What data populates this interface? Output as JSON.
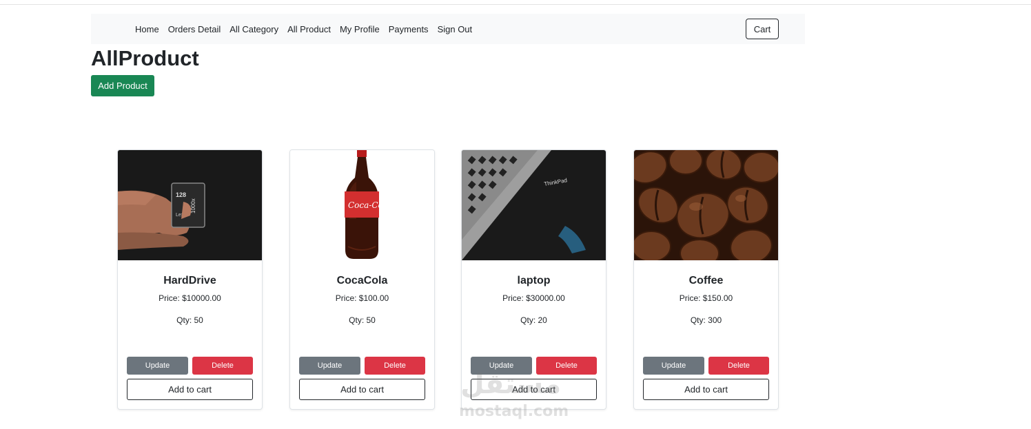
{
  "nav": {
    "links": [
      "Home",
      "Orders Detail",
      "All Category",
      "All Product",
      "My Profile",
      "Payments",
      "Sign Out"
    ],
    "cart_label": "Cart"
  },
  "page": {
    "title": "AllProduct",
    "add_product_label": "Add Product"
  },
  "products": [
    {
      "name": "HardDrive",
      "price": "Price: $10000.00",
      "qty": "Qty: 50",
      "image": "sd-card-photo"
    },
    {
      "name": "CocaCola",
      "price": "Price: $100.00",
      "qty": "Qty: 50",
      "image": "coca-cola-bottle-photo"
    },
    {
      "name": "laptop",
      "price": "Price: $30000.00",
      "qty": "Qty: 20",
      "image": "laptop-keyboard-photo"
    },
    {
      "name": "Coffee",
      "price": "Price: $150.00",
      "qty": "Qty: 300",
      "image": "coffee-beans-photo"
    }
  ],
  "card_buttons": {
    "update": "Update",
    "delete": "Delete",
    "add_to_cart": "Add to cart"
  },
  "watermark": {
    "arabic": "مستقل",
    "latin": "mostaql.com"
  },
  "colors": {
    "success": "#198754",
    "secondary": "#6c757d",
    "danger": "#dc3545",
    "navbar_bg": "#f8f9fa"
  }
}
